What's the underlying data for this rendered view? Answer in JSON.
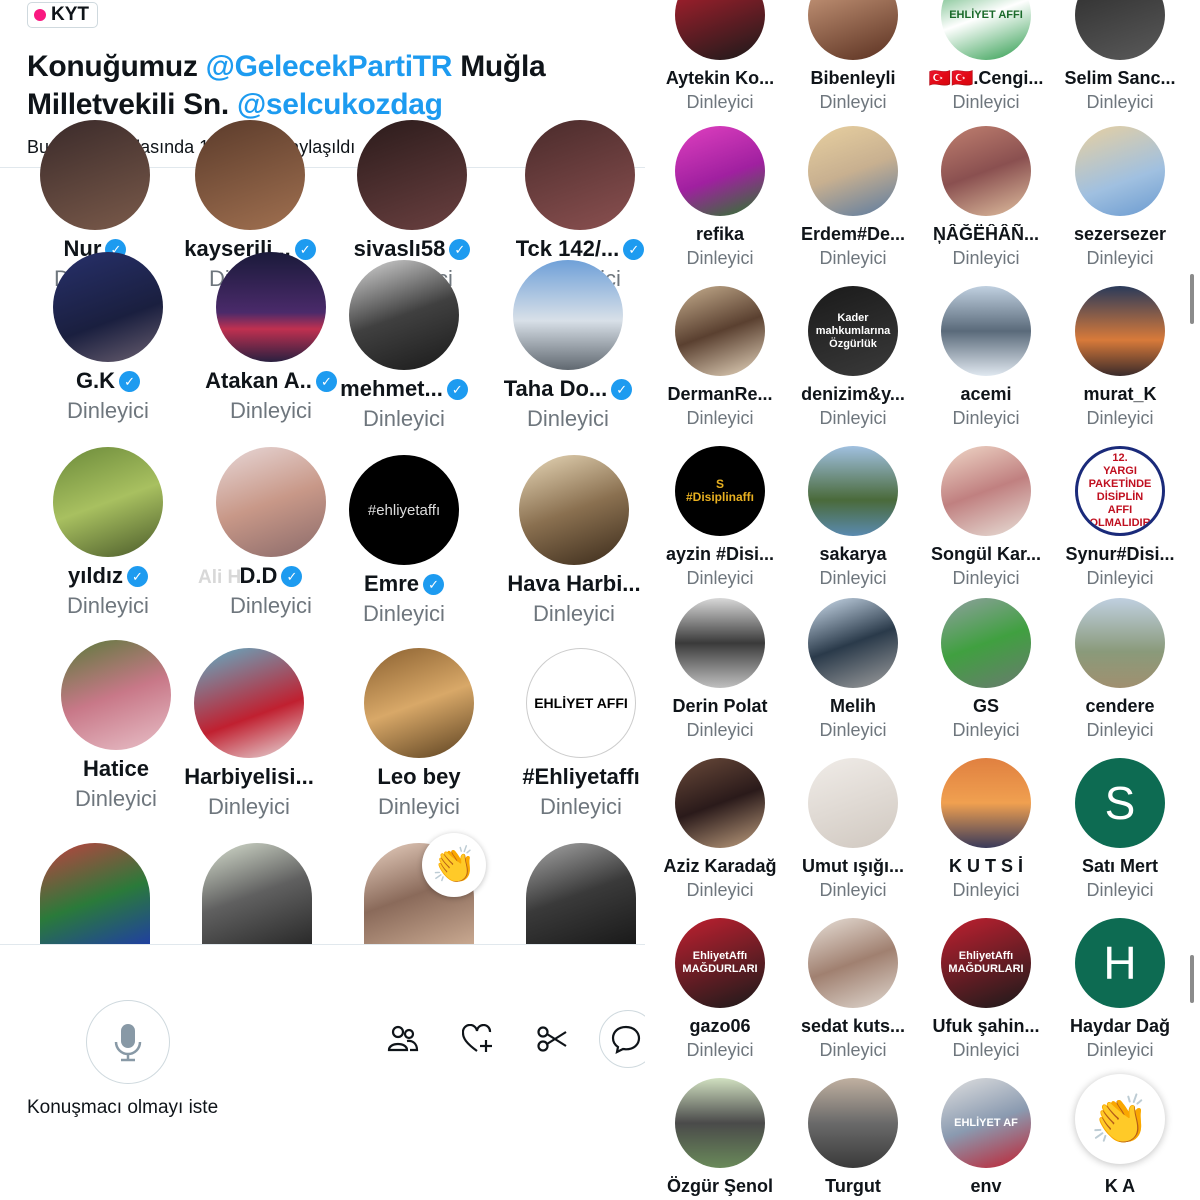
{
  "space": {
    "badge": "KYT",
    "title_parts": [
      "Konuğumuz ",
      "@GelecekPartiTR",
      " Muğla Milletvekili Sn. ",
      "@selcukozdag"
    ],
    "shared_note": "Bu Sohbet Odasında 1 gönderi paylaşıldı"
  },
  "left_participants": [
    {
      "name": "Nur",
      "role": "Dinleyici",
      "verified": true
    },
    {
      "name": "kayserili...",
      "role": "Dinleyici",
      "verified": true
    },
    {
      "name": "sivaslı58",
      "role": "Dinleyici",
      "verified": true
    },
    {
      "name": "Tck 142/...",
      "role": "Dinleyici",
      "verified": true
    },
    {
      "name": "G.K",
      "role": "Dinleyici",
      "verified": true
    },
    {
      "name": "Atakan A..",
      "role": "Dinleyici",
      "verified": true
    },
    {
      "name": "mehmet...",
      "role": "Dinleyici",
      "verified": true
    },
    {
      "name": "Taha Do...",
      "role": "Dinleyici",
      "verified": true
    },
    {
      "name": "yıldız",
      "role": "Dinleyici",
      "verified": true
    },
    {
      "name": "D.D",
      "role": "Dinleyici",
      "verified": true
    },
    {
      "name": "Emre",
      "role": "Dinleyici",
      "verified": true,
      "avatar_text": "#ehliyetaffı"
    },
    {
      "name": "Hava Harbi...",
      "role": "Dinleyici",
      "verified": false
    },
    {
      "name": "Hatice",
      "role": "Dinleyici",
      "verified": false
    },
    {
      "name": "Harbiyelisi...",
      "role": "Dinleyici",
      "verified": false
    },
    {
      "name": "Leo bey",
      "role": "Dinleyici",
      "verified": false
    },
    {
      "name": "#Ehliyetaffı",
      "role": "Dinleyici",
      "verified": false,
      "avatar_text": "EHLİYET AFFI"
    }
  ],
  "ghost_text": "Ali H",
  "controls": {
    "request_label": "Konuşmacı olmayı iste",
    "icons": [
      "microphone-icon",
      "people-icon",
      "heart-plus-icon",
      "scissors-icon",
      "reply-icon",
      "clap-icon"
    ]
  },
  "right_participants": [
    {
      "name": "Aytekin Ko...",
      "role": "Dinleyici"
    },
    {
      "name": "Bibenleyli",
      "role": "Dinleyici"
    },
    {
      "name": "🇹🇷🇹🇷.Cengi...",
      "role": "Dinleyici",
      "avatar_text": "EHLİYET AFFI"
    },
    {
      "name": "Selim Sanc...",
      "role": "Dinleyici"
    },
    {
      "name": "refika",
      "role": "Dinleyici"
    },
    {
      "name": "Erdem#De...",
      "role": "Dinleyici"
    },
    {
      "name": "ŅÂĞËĤÂÑ...",
      "role": "Dinleyici"
    },
    {
      "name": "sezersezer",
      "role": "Dinleyici"
    },
    {
      "name": "DermanRe...",
      "role": "Dinleyici"
    },
    {
      "name": "denizim&y...",
      "role": "Dinleyici",
      "avatar_text": "Kader mahkumlarına\nÖzgürlük"
    },
    {
      "name": "acemi",
      "role": "Dinleyici"
    },
    {
      "name": "murat_K",
      "role": "Dinleyici"
    },
    {
      "name": "ayzin #Disi...",
      "role": "Dinleyici",
      "avatar_text": "S\n#Disiplinaffı"
    },
    {
      "name": "sakarya",
      "role": "Dinleyici"
    },
    {
      "name": "Songül Kar...",
      "role": "Dinleyici"
    },
    {
      "name": "Synur#Disi...",
      "role": "Dinleyici",
      "avatar_text": "12.\nYARGI PAKETİNDE\nDİSİPLİN AFFI\nOLMALIDIR"
    },
    {
      "name": "Derin Polat",
      "role": "Dinleyici"
    },
    {
      "name": "Melih",
      "role": "Dinleyici"
    },
    {
      "name": "GS",
      "role": "Dinleyici"
    },
    {
      "name": "cendere",
      "role": "Dinleyici"
    },
    {
      "name": "Aziz Karadağ",
      "role": "Dinleyici"
    },
    {
      "name": "Umut ışığı...",
      "role": "Dinleyici"
    },
    {
      "name": "K U T S İ",
      "role": "Dinleyici"
    },
    {
      "name": "Satı Mert",
      "role": "Dinleyici",
      "avatar_letter": "S"
    },
    {
      "name": "gazo06",
      "role": "Dinleyici",
      "avatar_text": "EhliyetAffı\nMAĞDURLARI"
    },
    {
      "name": "sedat kuts...",
      "role": "Dinleyici"
    },
    {
      "name": "Ufuk şahin...",
      "role": "Dinleyici",
      "avatar_text": "EhliyetAffı\nMAĞDURLARI"
    },
    {
      "name": "Haydar Dağ",
      "role": "Dinleyici",
      "avatar_letter": "H"
    },
    {
      "name": "Özgür Şenol",
      "role": "Dinleyici"
    },
    {
      "name": "Turgut",
      "role": "Dinleyici"
    },
    {
      "name": "env",
      "role": "Dinleyici",
      "avatar_text": "EHLİYET AF"
    },
    {
      "name": "K A",
      "role": "Dinleyici"
    }
  ],
  "colors": {
    "accent": "#1d9bf0",
    "live_dot": "#f91880",
    "muted": "#6e767d",
    "letter_avatar": "#0d6b52"
  }
}
